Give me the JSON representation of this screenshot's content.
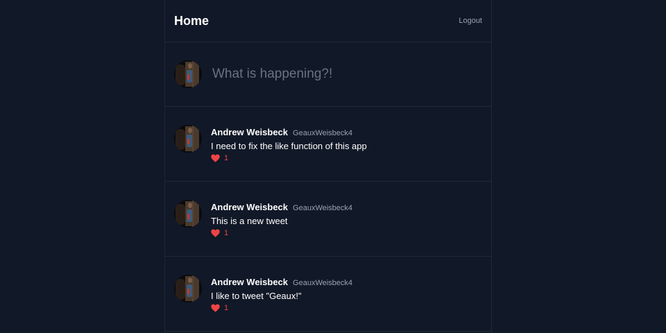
{
  "header": {
    "title": "Home",
    "logout_label": "Logout"
  },
  "composer": {
    "placeholder": "What is happening?!"
  },
  "colors": {
    "background": "#111827",
    "border": "#1f2937",
    "like": "#ef4444"
  },
  "icons": {
    "like": "heart-icon"
  },
  "tweets": [
    {
      "author": "Andrew Weisbeck",
      "handle": "GeauxWeisbeck4",
      "text": "I need to fix the like function of this app",
      "likes": "1"
    },
    {
      "author": "Andrew Weisbeck",
      "handle": "GeauxWeisbeck4",
      "text": "This is a new tweet",
      "likes": "1"
    },
    {
      "author": "Andrew Weisbeck",
      "handle": "GeauxWeisbeck4",
      "text": "I like to tweet \"Geaux!\"",
      "likes": "1"
    }
  ]
}
